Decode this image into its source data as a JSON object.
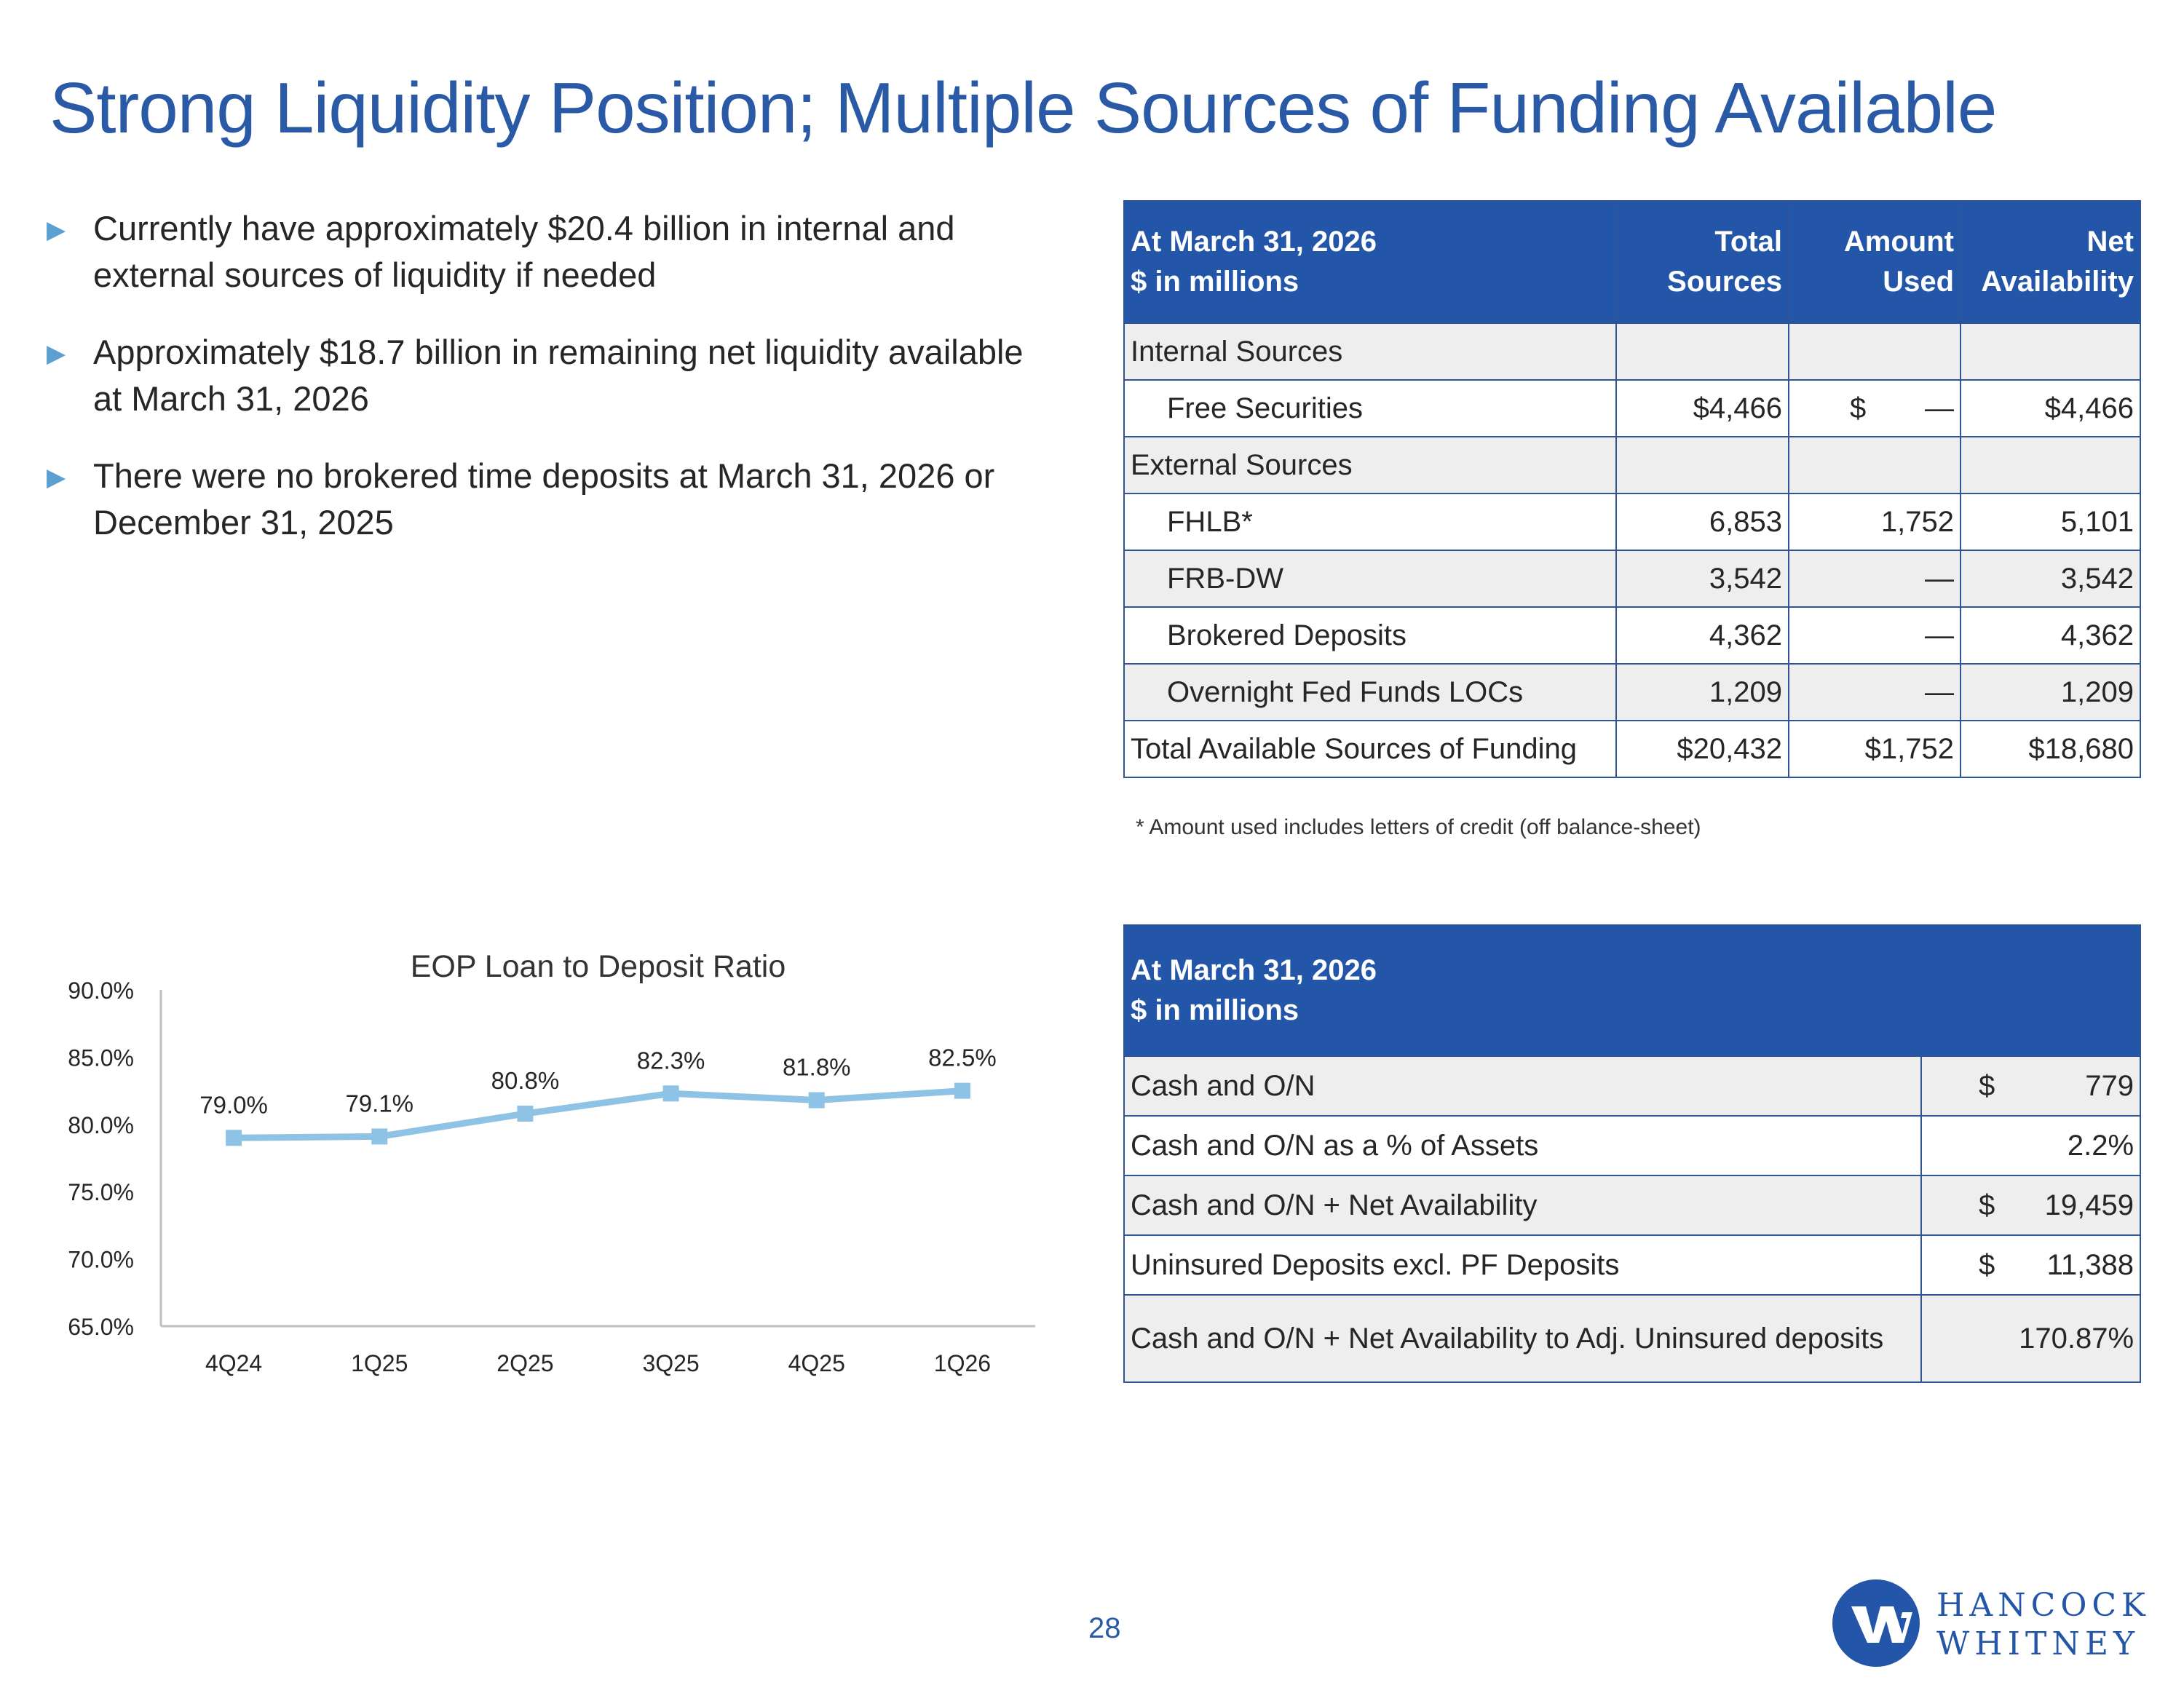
{
  "title": "Strong Liquidity Position; Multiple Sources of Funding Available",
  "bullets": [
    "Currently have approximately $20.4 billion in internal and external sources of liquidity if needed",
    "Approximately $18.7 billion in remaining net liquidity available at March 31, 2026",
    "There were no brokered time deposits at March 31, 2026 or December 31, 2025"
  ],
  "liquidity_table": {
    "header": {
      "date": "At March 31, 2026",
      "units": "$ in millions",
      "col1_line1": "Total",
      "col1_line2": "Sources",
      "col2_line1": "Amount",
      "col2_line2": "Used",
      "col3_line1": "Net",
      "col3_line2": "Availability"
    },
    "rows": {
      "internal": {
        "label": "Internal Sources"
      },
      "free_securities": {
        "label": "Free Securities",
        "total": "$4,466",
        "used_symbol": "$",
        "used": "—",
        "net": "$4,466"
      },
      "external": {
        "label": "External Sources"
      },
      "fhlb": {
        "label": "FHLB*",
        "total": "6,853",
        "used": "1,752",
        "net": "5,101"
      },
      "frb": {
        "label": "FRB-DW",
        "total": "3,542",
        "used": "—",
        "net": "3,542"
      },
      "brokered": {
        "label": "Brokered Deposits",
        "total": "4,362",
        "used": "—",
        "net": "4,362"
      },
      "overnight": {
        "label": "Overnight Fed Funds LOCs",
        "total": "1,209",
        "used": "—",
        "net": "1,209"
      },
      "total": {
        "label": "Total Available Sources of Funding",
        "total": "$20,432",
        "used": "$1,752",
        "net": "$18,680"
      }
    },
    "footnote": "* Amount used includes letters of credit (off balance-sheet)"
  },
  "cash_table": {
    "header": {
      "date": "At March 31, 2026",
      "units": "$ in millions"
    },
    "rows": [
      {
        "label": "Cash and O/N",
        "symbol": "$",
        "value": "779"
      },
      {
        "label": "Cash and O/N as a % of Assets",
        "symbol": "",
        "value": "2.2%"
      },
      {
        "label": "Cash and O/N + Net Availability",
        "symbol": "$",
        "value": "19,459"
      },
      {
        "label": "Uninsured Deposits excl. PF Deposits",
        "symbol": "$",
        "value": "11,388"
      },
      {
        "label": "Cash and O/N + Net Availability to Adj. Uninsured deposits",
        "symbol": "",
        "value": "170.87%"
      }
    ]
  },
  "chart_data": {
    "type": "line",
    "title": "EOP Loan to Deposit Ratio",
    "categories": [
      "4Q24",
      "1Q25",
      "2Q25",
      "3Q25",
      "4Q25",
      "1Q26"
    ],
    "values": [
      79.0,
      79.1,
      80.8,
      82.3,
      81.8,
      82.5
    ],
    "data_labels": [
      "79.0%",
      "79.1%",
      "80.8%",
      "82.3%",
      "81.8%",
      "82.5%"
    ],
    "y_ticks": [
      "90.0%",
      "85.0%",
      "80.0%",
      "75.0%",
      "70.0%",
      "65.0%"
    ],
    "ylim": [
      65,
      90
    ],
    "grid": false,
    "line_color": "#8fc3e6"
  },
  "page_number": "28",
  "logo": {
    "line1": "HANCOCK",
    "line2": "WHITNEY",
    "color": "#2356a8"
  }
}
